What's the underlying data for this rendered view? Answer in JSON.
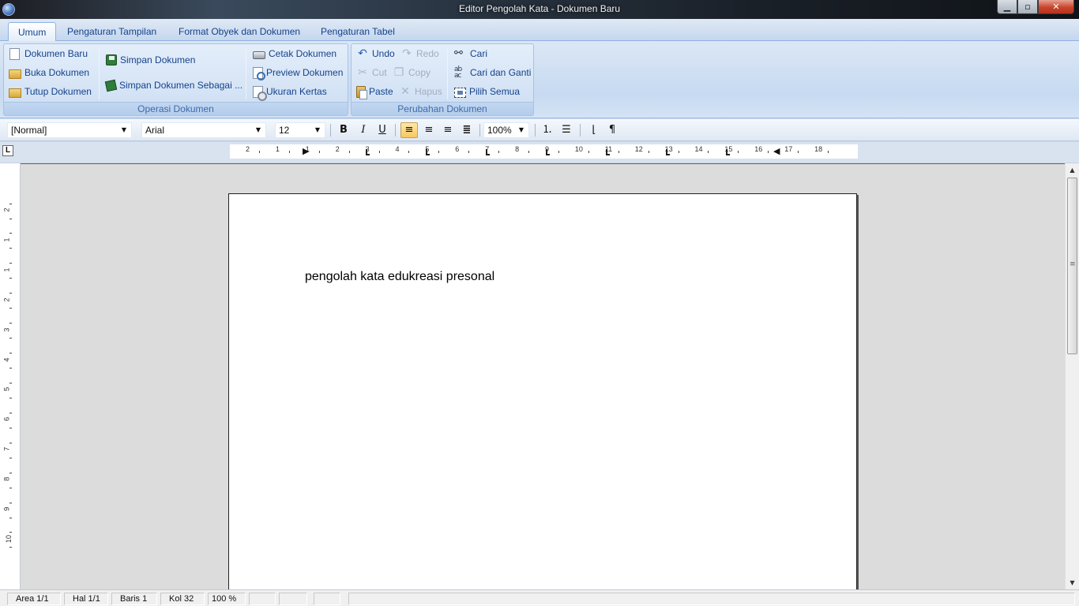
{
  "window": {
    "title": "Editor Pengolah Kata - Dokumen Baru",
    "minimize_glyph": "▁",
    "maximize_glyph": "▫",
    "close_glyph": "✕"
  },
  "ribbon_tabs": [
    "Umum",
    "Pengaturan Tampilan",
    "Format Obyek dan Dokumen",
    "Pengaturan Tabel"
  ],
  "groups": {
    "operasi": {
      "label": "Operasi Dokumen",
      "dokumen_baru": "Dokumen Baru",
      "buka_dokumen": "Buka Dokumen",
      "tutup_dokumen": "Tutup Dokumen",
      "simpan_dokumen": "Simpan Dokumen",
      "simpan_sebagai": "Simpan Dokumen Sebagai ...",
      "cetak_dokumen": "Cetak Dokumen",
      "preview_dokumen": "Preview Dokumen",
      "ukuran_kertas": "Ukuran Kertas"
    },
    "perubahan": {
      "label": "Perubahan Dokumen",
      "undo": "Undo",
      "redo": "Redo",
      "cut": "Cut",
      "copy": "Copy",
      "paste": "Paste",
      "hapus": "Hapus",
      "cari": "Cari",
      "cari_ganti": "Cari dan Ganti",
      "pilih_semua": "Pilih Semua"
    }
  },
  "format_toolbar": {
    "style": "[Normal]",
    "font": "Arial",
    "size": "12",
    "zoom": "100%",
    "bold": "B",
    "italic": "I",
    "underline": "U",
    "pilcrow": "¶"
  },
  "ruler": {
    "h_numbers": [
      "2",
      "1",
      "1",
      "2",
      "3",
      "4",
      "5",
      "6",
      "7",
      "8",
      "9",
      "10",
      "11",
      "12",
      "13",
      "14",
      "15",
      "16",
      "17",
      "18"
    ],
    "v_numbers": [
      "2",
      "1",
      "1",
      "2",
      "3",
      "4",
      "5",
      "6",
      "7",
      "8",
      "9",
      "10"
    ]
  },
  "document": {
    "text": "pengolah kata edukreasi presonal"
  },
  "statusbar": {
    "area": "Area 1/1",
    "hal": "Hal 1/1",
    "baris": "Baris 1",
    "kol": "Kol 32",
    "zoom": "100 %"
  }
}
